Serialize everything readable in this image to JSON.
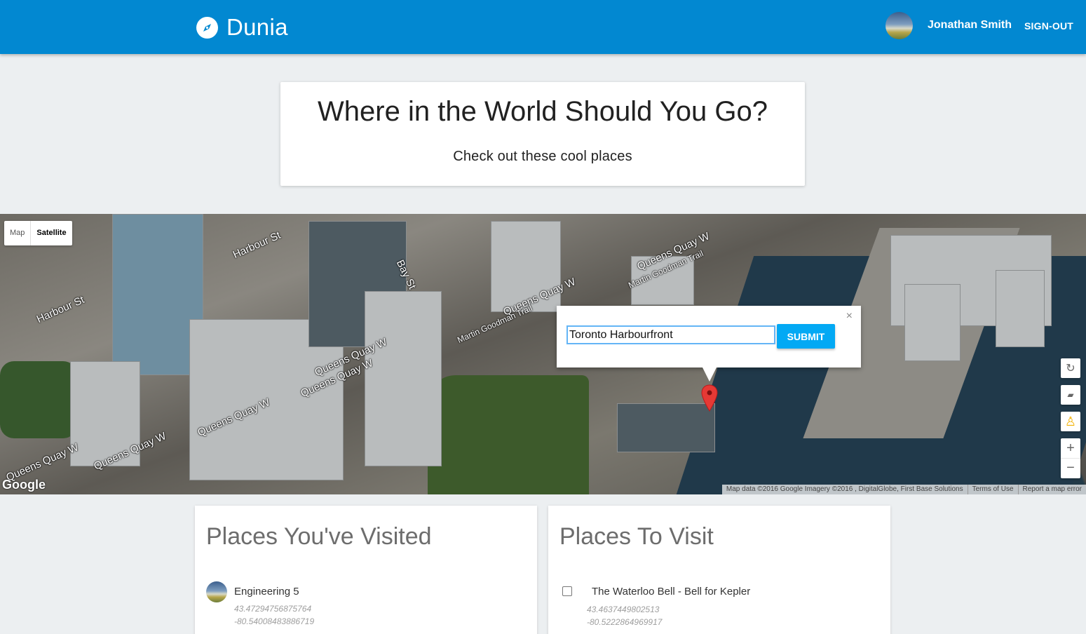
{
  "header": {
    "brand": "Dunia",
    "user_name": "Jonathan Smith",
    "signout_label": "SIGN-OUT"
  },
  "hero": {
    "title": "Where in the World Should You Go?",
    "subtitle": "Check out these cool places"
  },
  "map": {
    "type_buttons": [
      "Map",
      "Satellite"
    ],
    "active_type": "Satellite",
    "street_labels": [
      "Harbour St",
      "Harbour St",
      "Bay St",
      "Queens Quay W",
      "Queens Quay W",
      "Queens Quay W",
      "Queens Quay W",
      "Queens Quay W",
      "Queens Quay W",
      "Queens Quay W",
      "Martin Goodman Trail",
      "Martin Goodman Trail"
    ],
    "google_logo": "Google",
    "attribution": [
      "Map data ©2016 Google Imagery ©2016 , DigitalGlobe, First Base Solutions",
      "Terms of Use",
      "Report a map error"
    ],
    "info_window": {
      "input_value": "Toronto Harbourfront",
      "submit_label": "SUBMIT",
      "close_glyph": "×"
    },
    "controls": {
      "zoom_in": "+",
      "zoom_out": "−"
    }
  },
  "visited": {
    "title": "Places You've Visited",
    "items": [
      {
        "name": "Engineering 5",
        "lat": "43.47294756875764",
        "lng": "-80.54008483886719"
      }
    ]
  },
  "to_visit": {
    "title": "Places To Visit",
    "items": [
      {
        "name": "The Waterloo Bell - Bell for Kepler",
        "lat": "43.4637449802513",
        "lng": "-80.5222864969917"
      }
    ]
  },
  "colors": {
    "header": "#0288d1",
    "submit": "#03a9f4",
    "background": "#eceff1"
  }
}
